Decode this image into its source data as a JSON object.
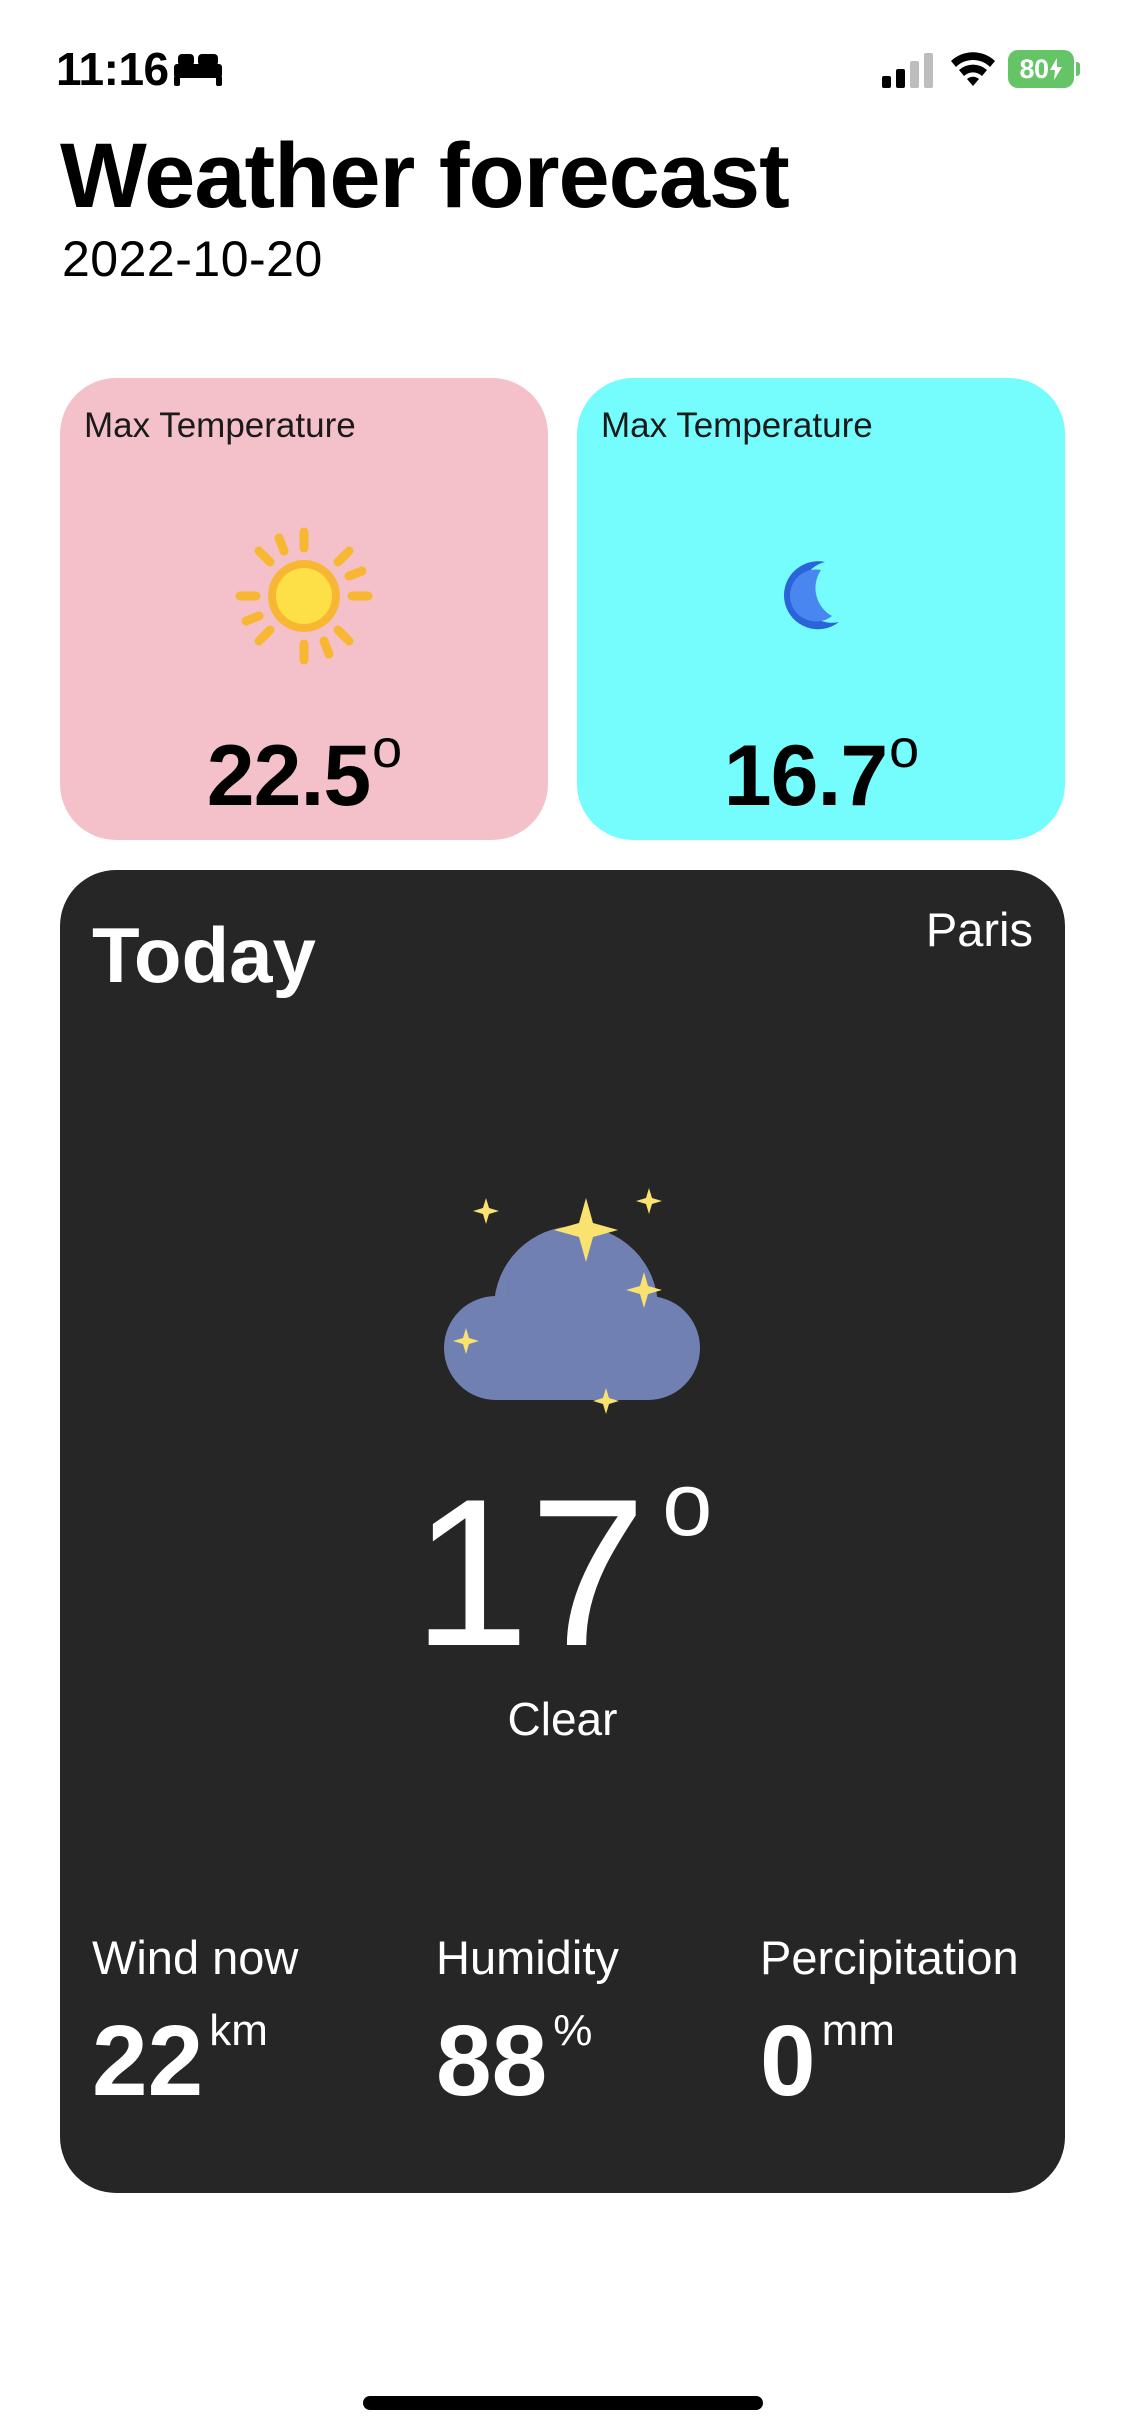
{
  "status_bar": {
    "time": "11:16",
    "battery": "80",
    "icons": [
      "bed-icon",
      "cellular-signal-icon",
      "wifi-icon",
      "battery-icon"
    ],
    "battery_color": "#65c466"
  },
  "header": {
    "title": "Weather forecast",
    "date": "2022-10-20"
  },
  "cards": [
    {
      "label": "Max Temperature",
      "icon": "sun-icon",
      "value": "22.5",
      "degree_symbol": "o",
      "background": "#f4c1ca"
    },
    {
      "label": "Max Temperature",
      "icon": "crescent-moon-icon",
      "value": "16.7",
      "degree_symbol": "o",
      "background": "#75fdfe"
    }
  ],
  "today": {
    "title": "Today",
    "city": "Paris",
    "icon": "night-cloud-moon-stars-icon",
    "temperature": "17",
    "degree_symbol": "o",
    "condition": "Clear",
    "background": "#262626",
    "stats": [
      {
        "label": "Wind now",
        "value": "22",
        "unit": "km"
      },
      {
        "label": "Humidity",
        "value": "88",
        "unit": "%"
      },
      {
        "label": "Percipitation",
        "value": "0",
        "unit": "mm"
      }
    ]
  }
}
